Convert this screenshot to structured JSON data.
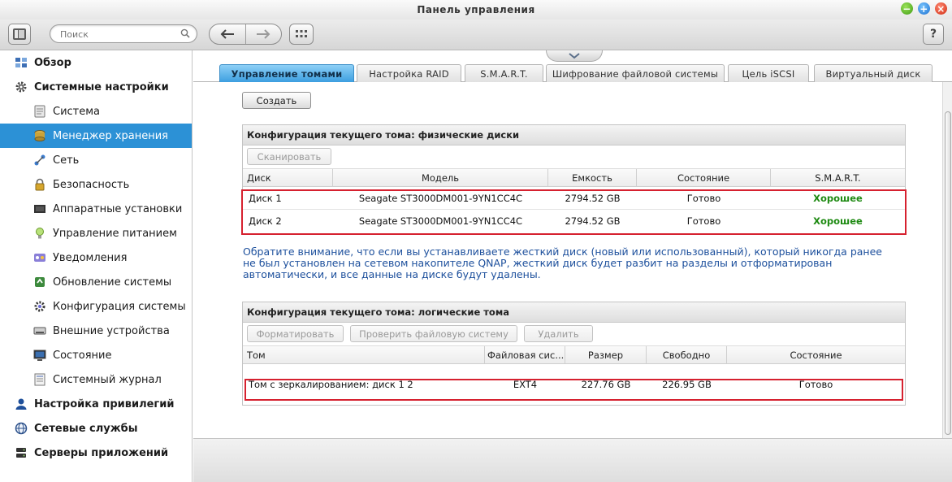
{
  "window": {
    "title": "Панель управления"
  },
  "toolbar": {
    "search_placeholder": "Поиск",
    "help_label": "?"
  },
  "sidebar": {
    "items": [
      {
        "label": "Обзор",
        "level": "top",
        "icon": "overview-icon",
        "active": false
      },
      {
        "label": "Системные настройки",
        "level": "top",
        "icon": "gear-icon",
        "active": false
      },
      {
        "label": "Система",
        "level": "sub",
        "icon": "system-icon",
        "active": false
      },
      {
        "label": "Менеджер хранения",
        "level": "sub",
        "icon": "storage-icon",
        "active": true
      },
      {
        "label": "Сеть",
        "level": "sub",
        "icon": "network-icon",
        "active": false
      },
      {
        "label": "Безопасность",
        "level": "sub",
        "icon": "lock-icon",
        "active": false
      },
      {
        "label": "Аппаратные установки",
        "level": "sub",
        "icon": "hardware-icon",
        "active": false
      },
      {
        "label": "Управление питанием",
        "level": "sub",
        "icon": "power-bulb-icon",
        "active": false
      },
      {
        "label": "Уведомления",
        "level": "sub",
        "icon": "notification-icon",
        "active": false
      },
      {
        "label": "Обновление системы",
        "level": "sub",
        "icon": "update-icon",
        "active": false
      },
      {
        "label": "Конфигурация системы",
        "level": "sub",
        "icon": "config-icon",
        "active": false
      },
      {
        "label": "Внешние устройства",
        "level": "sub",
        "icon": "external-device-icon",
        "active": false
      },
      {
        "label": "Состояние",
        "level": "sub",
        "icon": "monitor-icon",
        "active": false
      },
      {
        "label": "Системный журнал",
        "level": "sub",
        "icon": "log-icon",
        "active": false
      },
      {
        "label": "Настройка привилегий",
        "level": "top",
        "icon": "user-icon",
        "active": false
      },
      {
        "label": "Сетевые службы",
        "level": "top",
        "icon": "globe-icon",
        "active": false
      },
      {
        "label": "Серверы приложений",
        "level": "top",
        "icon": "server-icon",
        "active": false
      }
    ]
  },
  "tabs": [
    {
      "label": "Управление томами",
      "active": true
    },
    {
      "label": "Настройка RAID",
      "active": false
    },
    {
      "label": "S.M.A.R.T.",
      "active": false
    },
    {
      "label": "Шифрование файловой системы",
      "active": false
    },
    {
      "label": "Цель iSCSI",
      "active": false
    },
    {
      "label": "Виртуальный диск",
      "active": false
    }
  ],
  "main": {
    "create_label": "Создать",
    "physical": {
      "title": "Конфигурация текущего тома: физические диски",
      "scan_label": "Сканировать",
      "columns": [
        "Диск",
        "Модель",
        "Емкость",
        "Состояние",
        "S.M.A.R.T."
      ],
      "rows": [
        {
          "disk": "Диск 1",
          "model": "Seagate ST3000DM001-9YN1CC4C",
          "capacity": "2794.52 GB",
          "status": "Готово",
          "smart": "Хорошее"
        },
        {
          "disk": "Диск 2",
          "model": "Seagate ST3000DM001-9YN1CC4C",
          "capacity": "2794.52 GB",
          "status": "Готово",
          "smart": "Хорошее"
        }
      ]
    },
    "notice": "Обратите внимание, что если вы устанавливаете жесткий диск (новый или использованный), который никогда ранее не был установлен на сетевом накопителе QNAP, жесткий диск будет разбит на разделы и отформатирован автоматически, и все данные на диске будут удалены.",
    "logical": {
      "title": "Конфигурация текущего тома: логические тома",
      "format_label": "Форматировать",
      "check_label": "Проверить файловую систему",
      "delete_label": "Удалить",
      "columns": [
        "Том",
        "Файловая сис...",
        "Размер",
        "Свободно",
        "Состояние"
      ],
      "rows": [
        {
          "volume": "Том с зеркалированием: диск 1 2",
          "fs": "EXT4",
          "size": "227.76 GB",
          "free": "226.95 GB",
          "status": "Готово"
        }
      ]
    }
  },
  "colors": {
    "accent": "#2c91d6",
    "highlight_border": "#d6212f",
    "good_status": "#1e8a12",
    "notice_text": "#1c4f9c"
  }
}
